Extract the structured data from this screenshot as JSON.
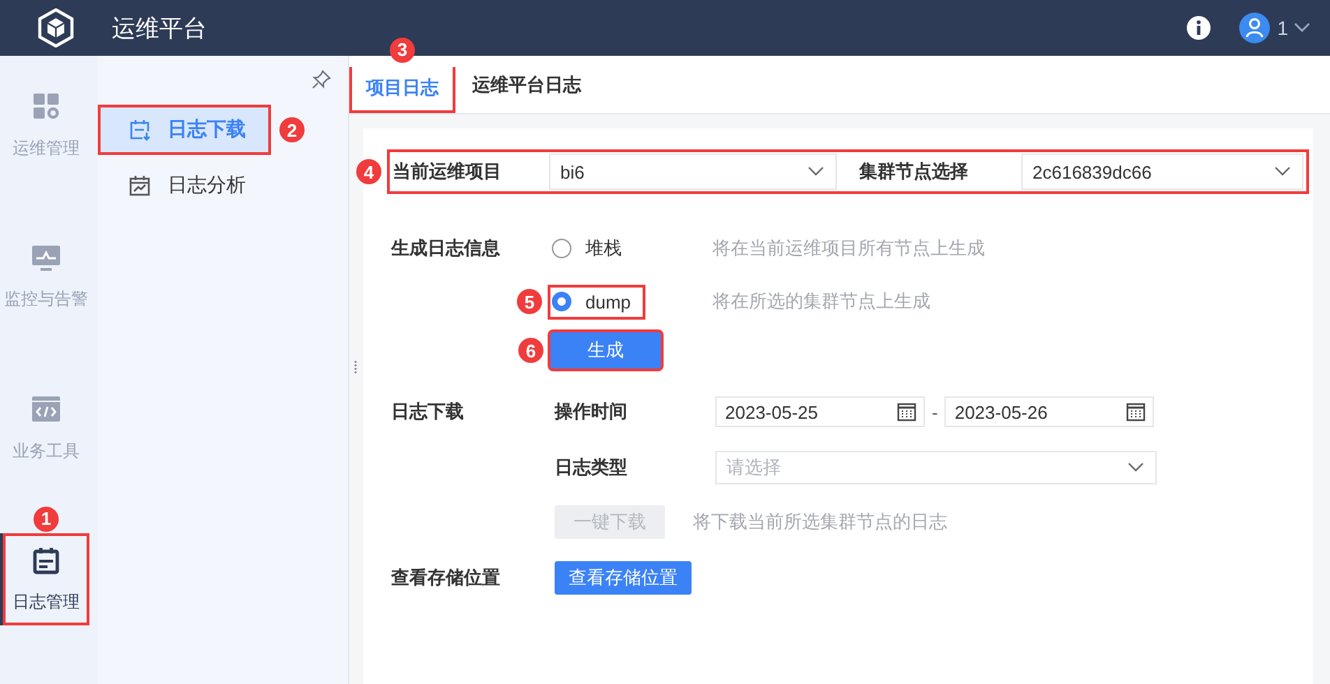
{
  "header": {
    "title": "运维平台",
    "user": "1"
  },
  "rail": [
    {
      "label": "运维管理",
      "selected": false,
      "highlighted": false
    },
    {
      "label": "监控与告警",
      "selected": false,
      "highlighted": false
    },
    {
      "label": "业务工具",
      "selected": false,
      "highlighted": false
    },
    {
      "label": "日志管理",
      "selected": true,
      "highlighted": true,
      "marker": "1"
    }
  ],
  "submenu": [
    {
      "label": "日志下载",
      "selected": true,
      "highlighted": true,
      "marker": "2"
    },
    {
      "label": "日志分析",
      "selected": false,
      "highlighted": false
    }
  ],
  "tabs": [
    {
      "label": "项目日志",
      "selected": true,
      "highlighted": true,
      "marker": "3"
    },
    {
      "label": "运维平台日志",
      "selected": false,
      "highlighted": false
    }
  ],
  "scope": {
    "highlighted": true,
    "marker": "4",
    "project_label": "当前运维项目",
    "project_value": "bi6",
    "node_label": "集群节点选择",
    "node_value": "2c616839dc66"
  },
  "generate": {
    "label": "生成日志信息",
    "options": [
      {
        "label": "堆栈",
        "hint": "将在当前运维项目所有节点上生成",
        "selected": false,
        "highlighted": false
      },
      {
        "label": "dump",
        "hint": "将在所选的集群节点上生成",
        "selected": true,
        "highlighted": true,
        "marker": "5"
      }
    ],
    "button": {
      "label": "生成",
      "highlighted": true,
      "marker": "6"
    }
  },
  "download": {
    "label": "日志下载",
    "time_label": "操作时间",
    "date_from": "2023-05-25",
    "separator": "-",
    "date_to": "2023-05-26",
    "type_label": "日志类型",
    "type_placeholder": "请选择",
    "button": {
      "label": "一键下载",
      "disabled": true
    },
    "hint": "将下载当前所选集群节点的日志"
  },
  "storage": {
    "label": "查看存储位置",
    "button": "查看存储位置"
  }
}
